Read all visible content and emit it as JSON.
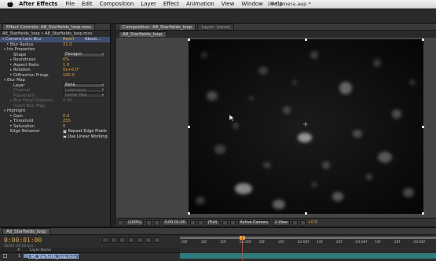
{
  "menubar": {
    "app_name": "After Effects",
    "items": [
      "File",
      "Edit",
      "Composition",
      "Layer",
      "Effect",
      "Animation",
      "View",
      "Window",
      "Help"
    ],
    "document_title": "14-Camera.aep *"
  },
  "effect_controls": {
    "tab_label": "Effect Controls: A8_Starfields_loop.mov",
    "breadcrumb": "A8_Starfields_loop • A8_Starfields_loop.mov",
    "effect_name": "Camera Lens Blur",
    "reset_label": "Reset",
    "about_label": "About...",
    "blur_radius_label": "Blur Radius",
    "blur_radius_value": "21.0",
    "iris_properties_label": "Iris Properties",
    "shape_label": "Shape",
    "shape_value": "Decagon",
    "roundness_label": "Roundness",
    "roundness_value": "0%",
    "aspect_ratio_label": "Aspect Ratio",
    "aspect_ratio_value": "1.0",
    "rotation_label": "Rotation",
    "rotation_value": "0x+0.0°",
    "diffraction_label": "Diffraction Fringe",
    "diffraction_value": "100.0",
    "blur_map_label": "Blur Map",
    "layer_label": "Layer",
    "layer_value": "None",
    "channel_label": "Channel",
    "channel_value": "Luminance",
    "placement_label": "Placement",
    "placement_value": "Center Map",
    "blur_focal_label": "Blur Focal Distance",
    "blur_focal_value": "0.00",
    "invert_label": "Invert Blur Map",
    "highlight_label": "Highlight",
    "gain_label": "Gain",
    "gain_value": "0.0",
    "threshold_label": "Threshold",
    "threshold_value": "255",
    "saturation_label": "Saturation",
    "saturation_value": "0",
    "edge_label": "Edge Behavior",
    "repeat_edge_label": "Repeat Edge Pixels",
    "linear_label": "Use Linear Working"
  },
  "composition": {
    "tab_label": "Composition: A8_Starfields_loop",
    "layer_tab_label": "Layer: (none)",
    "subtab_label": "A8_Starfields_loop",
    "footer": {
      "zoom": "(100%)",
      "timecode": "0:00:01:00",
      "resolution": "(Full)",
      "camera": "Active Camera",
      "views": "1 View",
      "exposure": "+0.0"
    }
  },
  "timeline": {
    "tab_label": "A8_Starfields_loop",
    "current_time": "0:00:01:00",
    "fps_info": "00025 (25.00 fps)",
    "col_source": "#",
    "col_layer_name": "Layer Name",
    "layer_index": "1",
    "layer_name": "A8_Starfields_loop.mov",
    "ruler_ticks": [
      "00f",
      "10f",
      "20f",
      "01:00f",
      "10f",
      "20f",
      "02:00f",
      "10f",
      "20f",
      "03:00f",
      "10f",
      "20f",
      "04:00f"
    ]
  },
  "colors": {
    "value_orange": "#e8a53a",
    "playhead_red": "#e8352a",
    "layer_bar_teal": "#2f7b7c",
    "panel_bg": "#2c2c2c"
  }
}
